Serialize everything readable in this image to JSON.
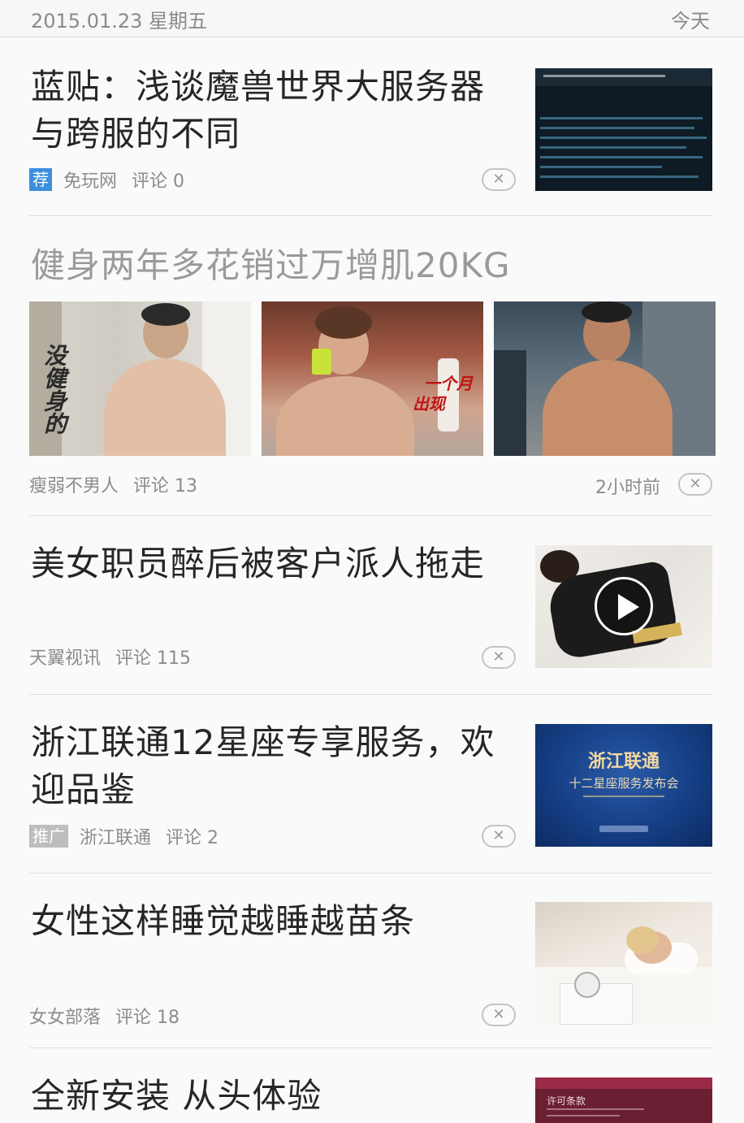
{
  "header": {
    "date": "2015.01.23 星期五",
    "today_label": "今天"
  },
  "feed": [
    {
      "title": "蓝贴：浅谈魔兽世界大服务器与跨服的不同",
      "tag": "荐",
      "source": "免玩网",
      "comments": "评论 0",
      "thumbnail_icon": "game-screenshot"
    },
    {
      "title": "健身两年多花销过万增肌20KG",
      "source": "瘦弱不男人",
      "comments": "评论 13",
      "time": "2小时前",
      "overlay_text_1": "没健身的",
      "overlay_text_2": "一个月",
      "overlay_text_3": "出现"
    },
    {
      "title": "美女职员醉后被客户派人拖走",
      "source": "天翼视讯",
      "comments": "评论 115",
      "thumbnail_icon": "play-icon"
    },
    {
      "title": "浙江联通12星座专享服务，欢迎品鉴",
      "tag": "推广",
      "source": "浙江联通",
      "comments": "评论 2",
      "thumb_text_1": "浙江联通",
      "thumb_text_2": "十二星座服务发布会"
    },
    {
      "title": "女性这样睡觉越睡越苗条",
      "source": "女女部落",
      "comments": "评论 18"
    },
    {
      "title": "全新安装 从头体验",
      "thumb_text_1": "许可条款"
    }
  ],
  "colors": {
    "recommend_tag": "#3d8fdc",
    "promo_tag": "#bdbdbd",
    "text_meta": "#8c8c8c"
  }
}
